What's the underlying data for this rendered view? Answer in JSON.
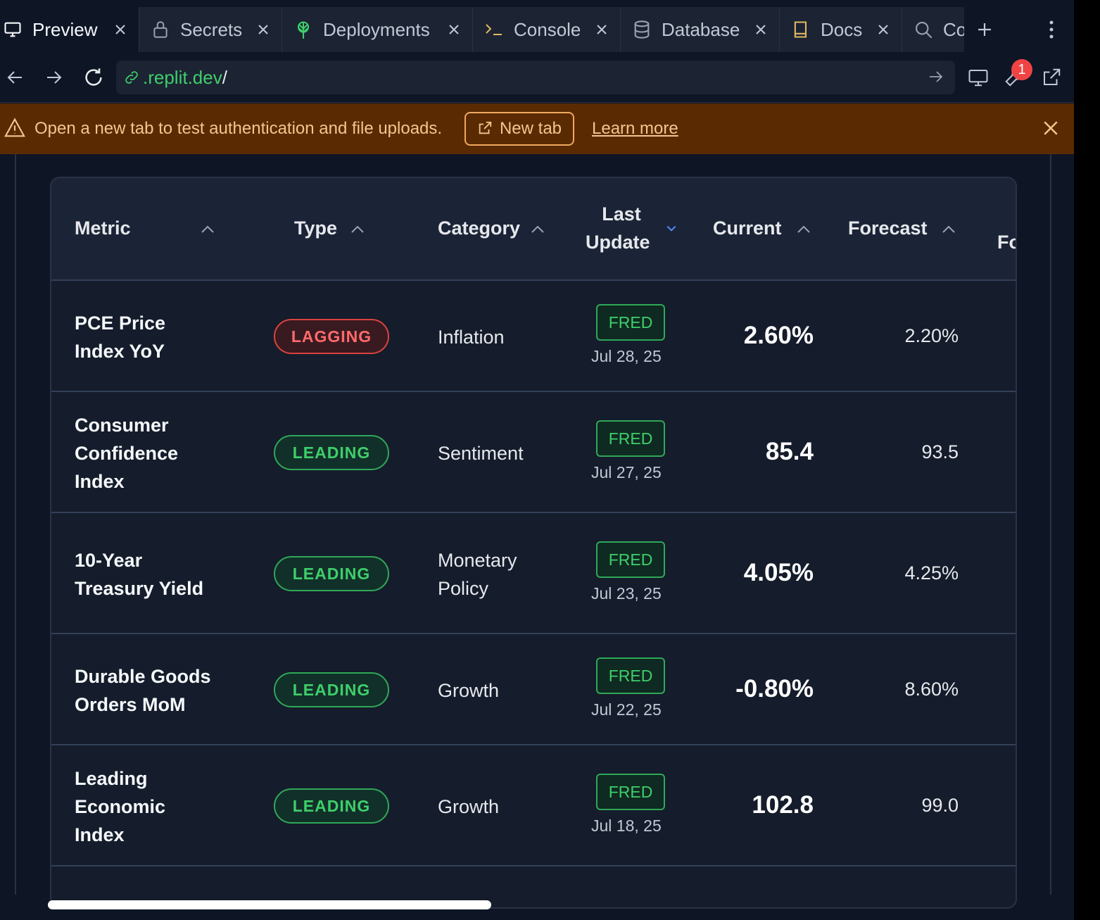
{
  "tabs": [
    {
      "label": "Preview",
      "icon": "monitor-icon",
      "active": true
    },
    {
      "label": "Secrets",
      "icon": "lock-icon"
    },
    {
      "label": "Deployments",
      "icon": "deploy-icon"
    },
    {
      "label": "Console",
      "icon": "terminal-icon"
    },
    {
      "label": "Database",
      "icon": "database-icon"
    },
    {
      "label": "Docs",
      "icon": "book-icon"
    },
    {
      "label": "Co",
      "icon": "search-icon"
    }
  ],
  "url": {
    "host": ".replit.dev",
    "path": "/"
  },
  "devtools_badge": "1",
  "banner": {
    "message": "Open a new tab to test authentication and file uploads.",
    "new_tab_label": "New tab",
    "learn_more_label": "Learn more"
  },
  "table": {
    "headers": {
      "metric": "Metric",
      "type": "Type",
      "category": "Category",
      "last_update_1": "Last",
      "last_update_2": "Update",
      "current": "Current",
      "forecast": "Forecast",
      "partial": "Fo"
    },
    "rows": [
      {
        "metric": [
          "PCE Price",
          "Index YoY"
        ],
        "type": "LAGGING",
        "category": [
          "Inflation"
        ],
        "source": "FRED",
        "date": "Jul 28, 25",
        "current": "2.60%",
        "forecast": "2.20%"
      },
      {
        "metric": [
          "Consumer",
          "Confidence",
          "Index"
        ],
        "type": "LEADING",
        "category": [
          "Sentiment"
        ],
        "source": "FRED",
        "date": "Jul 27, 25",
        "current": "85.4",
        "forecast": "93.5"
      },
      {
        "metric": [
          "10-Year",
          "Treasury Yield"
        ],
        "type": "LEADING",
        "category": [
          "Monetary",
          "Policy"
        ],
        "source": "FRED",
        "date": "Jul 23, 25",
        "current": "4.05%",
        "forecast": "4.25%"
      },
      {
        "metric": [
          "Durable Goods",
          "Orders MoM"
        ],
        "type": "LEADING",
        "category": [
          "Growth"
        ],
        "source": "FRED",
        "date": "Jul 22, 25",
        "current": "-0.80%",
        "forecast": "8.60%"
      },
      {
        "metric": [
          "Leading",
          "Economic",
          "Index"
        ],
        "type": "LEADING",
        "category": [
          "Growth"
        ],
        "source": "FRED",
        "date": "Jul 18, 25",
        "current": "102.8",
        "forecast": "99.0"
      }
    ]
  },
  "colors": {
    "lagging": "#ff6b6b",
    "leading": "#3ecf6a",
    "banner": "#5a2b02"
  }
}
